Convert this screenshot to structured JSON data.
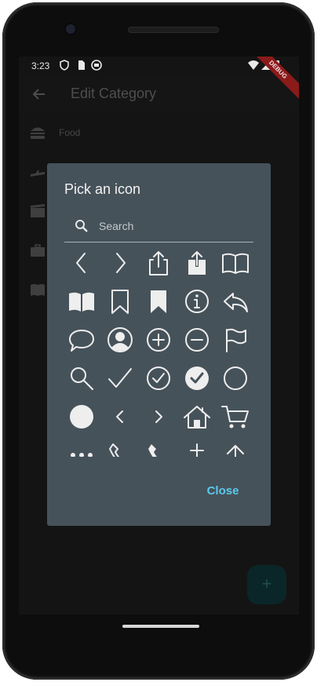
{
  "status_bar": {
    "time": "3:23"
  },
  "app_bar": {
    "title": "Edit Category",
    "debug_banner": "DEBUG"
  },
  "list": {
    "items": [
      {
        "label": "Food",
        "icon": "burger-icon"
      }
    ]
  },
  "dialog": {
    "title": "Pick an icon",
    "search": {
      "placeholder": "Search",
      "value": ""
    },
    "close_label": "Close",
    "icons": [
      "chevron-left-icon",
      "chevron-right-icon",
      "share-outline-icon",
      "share-filled-icon",
      "book-outline-icon",
      "book-filled-icon",
      "bookmark-outline-icon",
      "bookmark-filled-icon",
      "info-icon",
      "reply-icon",
      "chat-bubble-icon",
      "person-circle-icon",
      "add-circle-icon",
      "remove-circle-icon",
      "flag-icon",
      "search-icon",
      "checkmark-icon",
      "check-circle-outline-icon",
      "check-circle-filled-icon",
      "circle-outline-icon",
      "circle-filled-icon",
      "chevron-left-small-icon",
      "chevron-right-small-icon",
      "home-icon",
      "cart-icon",
      "ellipsis-icon",
      "phone-outline-icon",
      "phone-filled-icon",
      "anchor-icon",
      "arrow-up-icon"
    ]
  },
  "colors": {
    "accent": "#5bc9ee",
    "dialog_bg": "#46525a",
    "screen_bg": "#141414"
  }
}
